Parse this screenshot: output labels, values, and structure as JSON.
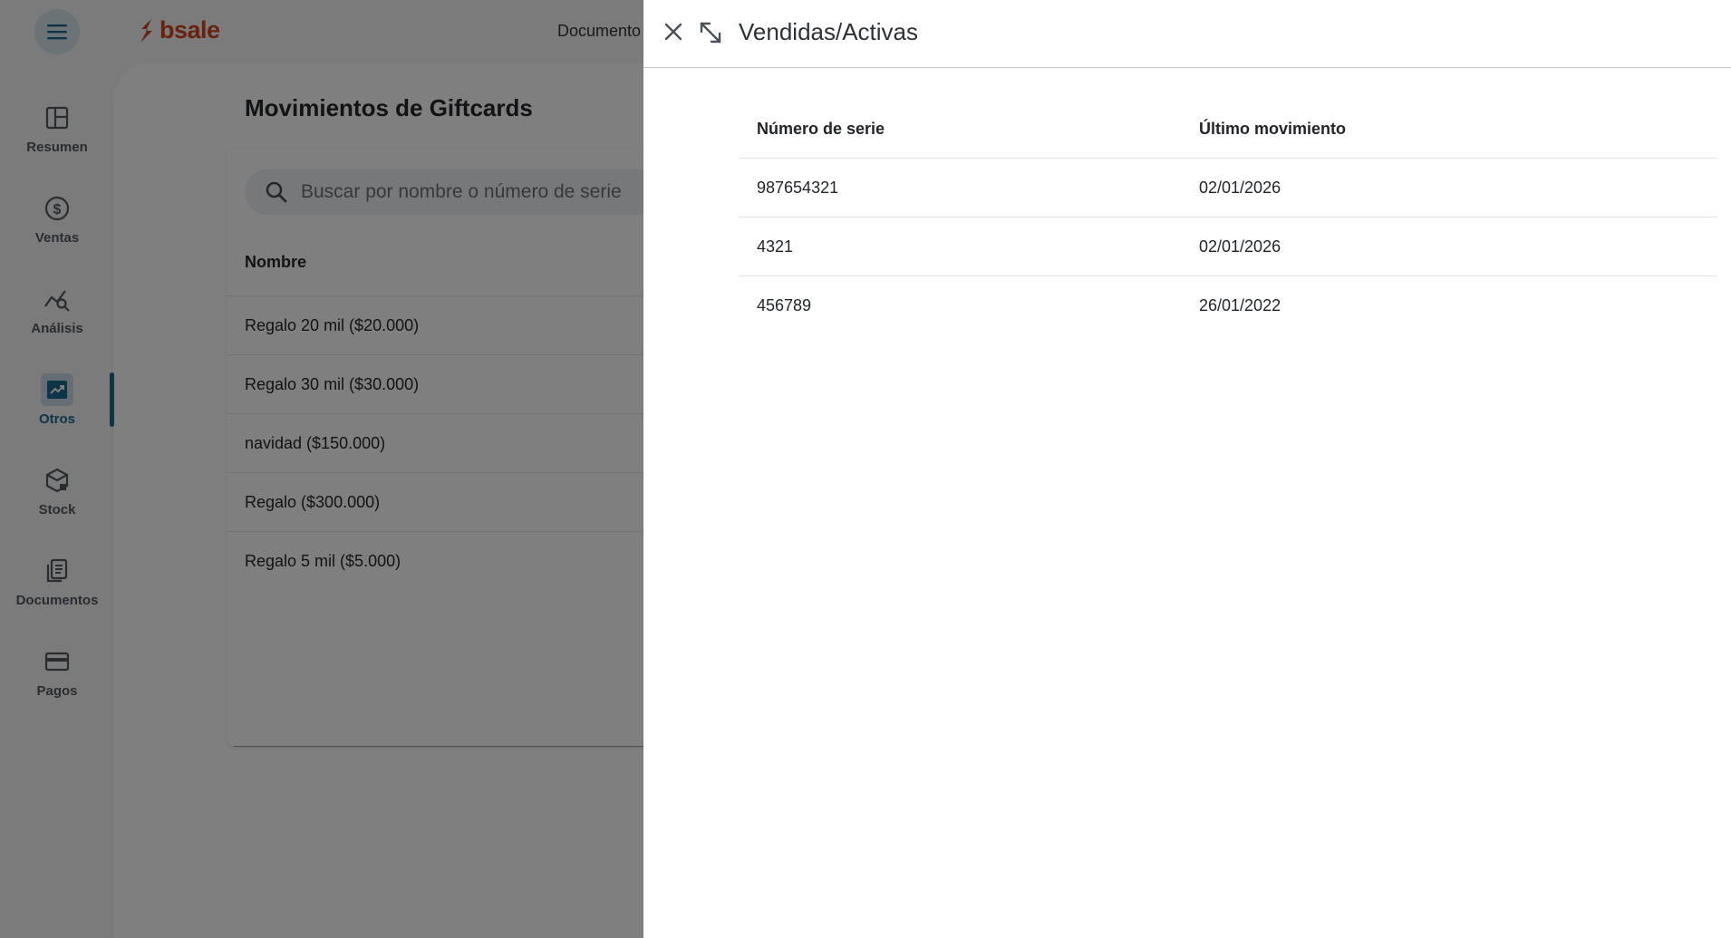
{
  "brand": {
    "name": "bsale",
    "color": "#d2451e",
    "accent": "#1a6a8e"
  },
  "header": {
    "top_link": "Documento"
  },
  "sidebar": {
    "items": [
      {
        "label": "Resumen",
        "icon": "layout-icon"
      },
      {
        "label": "Ventas",
        "icon": "dollar-icon"
      },
      {
        "label": "Análisis",
        "icon": "analytics-icon"
      },
      {
        "label": "Otros",
        "icon": "trending-icon",
        "active": true
      },
      {
        "label": "Stock",
        "icon": "box-icon"
      },
      {
        "label": "Documentos",
        "icon": "documents-icon"
      },
      {
        "label": "Pagos",
        "icon": "card-icon"
      }
    ]
  },
  "main": {
    "title": "Movimientos de Giftcards",
    "search": {
      "placeholder": "Buscar por nombre o número de serie",
      "value": ""
    },
    "table": {
      "column": "Nombre",
      "rows": [
        "Regalo 20 mil ($20.000)",
        "Regalo 30 mil ($30.000)",
        "navidad ($150.000)",
        "Regalo ($300.000)",
        "Regalo 5 mil ($5.000)"
      ]
    }
  },
  "drawer": {
    "title": "Vendidas/Activas",
    "columns": [
      "Número de serie",
      "Último movimiento"
    ],
    "rows": [
      {
        "serial": "987654321",
        "last": "02/01/2026"
      },
      {
        "serial": "4321",
        "last": "02/01/2026"
      },
      {
        "serial": "456789",
        "last": "26/01/2022"
      }
    ]
  }
}
